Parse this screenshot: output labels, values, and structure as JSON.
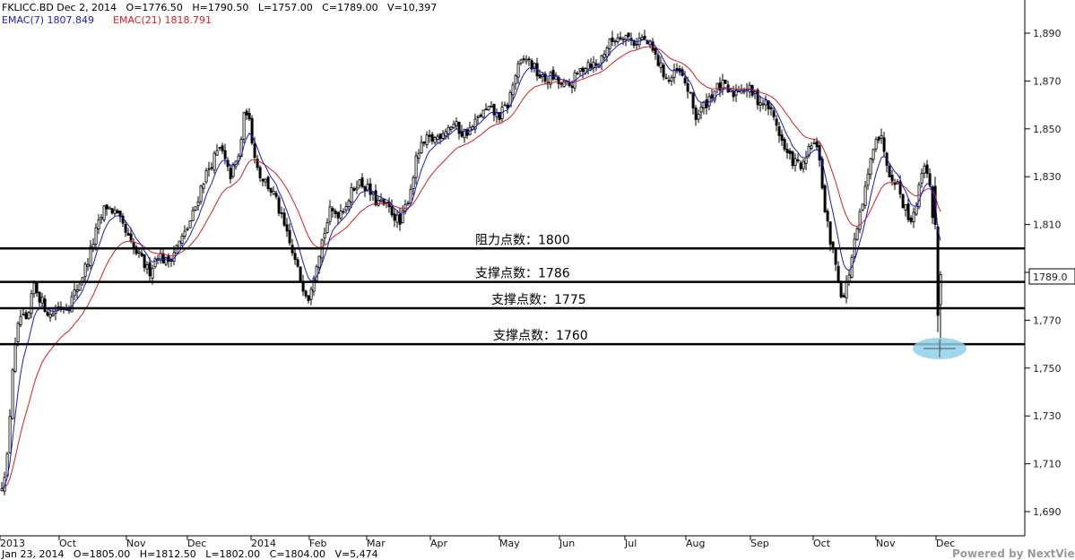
{
  "header": {
    "line1": "FKLICC.BD Dec 2, 2014   O=1776.50   H=1790.50   L=1757.00   C=1789.00   V=10,397",
    "ema7": "EMAC(7) 1807.849",
    "ema21": "EMAC(21) 1818.791"
  },
  "footer": {
    "info": "Jan 23, 2014   O=1805.00   H=1812.50   L=1802.00   C=1804.00   V=5,474",
    "credit": "Powered by NextView"
  },
  "price_badge": "1789.0",
  "colors": {
    "ema7": "#1a1acc",
    "ema21": "#d42020",
    "candle": "#000000",
    "marker": "#8fd0e6",
    "grid": "#000000"
  },
  "chart_data": {
    "type": "candlestick",
    "yticks": [
      1690,
      1710,
      1730,
      1750,
      1770,
      1790,
      1810,
      1830,
      1850,
      1870,
      1890
    ],
    "ytick_labels": [
      "1,690",
      "1,710",
      "1,730",
      "1,750",
      "1,770",
      "1,790",
      "1,810",
      "1,830",
      "1,850",
      "1,870",
      "1,890"
    ],
    "xtick_labels": [
      "2013",
      "Oct",
      "Nov",
      "Dec",
      "2014",
      "Feb",
      "Mar",
      "Apr",
      "May",
      "Jun",
      "Jul",
      "Aug",
      "Sep",
      "Oct",
      "Nov",
      "Dec"
    ],
    "close_path": [
      [
        0,
        1698
      ],
      [
        8,
        1712
      ],
      [
        14,
        1750
      ],
      [
        22,
        1772
      ],
      [
        30,
        1768
      ],
      [
        38,
        1785
      ],
      [
        46,
        1778
      ],
      [
        56,
        1772
      ],
      [
        66,
        1776
      ],
      [
        76,
        1776
      ],
      [
        88,
        1785
      ],
      [
        98,
        1795
      ],
      [
        108,
        1808
      ],
      [
        118,
        1818
      ],
      [
        128,
        1815
      ],
      [
        138,
        1808
      ],
      [
        148,
        1800
      ],
      [
        158,
        1795
      ],
      [
        166,
        1790
      ],
      [
        176,
        1798
      ],
      [
        186,
        1794
      ],
      [
        196,
        1800
      ],
      [
        206,
        1806
      ],
      [
        216,
        1815
      ],
      [
        226,
        1828
      ],
      [
        236,
        1836
      ],
      [
        246,
        1842
      ],
      [
        256,
        1830
      ],
      [
        266,
        1838
      ],
      [
        274,
        1860
      ],
      [
        280,
        1848
      ],
      [
        288,
        1832
      ],
      [
        296,
        1828
      ],
      [
        306,
        1822
      ],
      [
        316,
        1810
      ],
      [
        326,
        1798
      ],
      [
        336,
        1786
      ],
      [
        344,
        1780
      ],
      [
        350,
        1790
      ],
      [
        358,
        1802
      ],
      [
        368,
        1815
      ],
      [
        378,
        1815
      ],
      [
        388,
        1820
      ],
      [
        398,
        1828
      ],
      [
        408,
        1826
      ],
      [
        418,
        1820
      ],
      [
        428,
        1818
      ],
      [
        438,
        1815
      ],
      [
        446,
        1810
      ],
      [
        456,
        1822
      ],
      [
        466,
        1840
      ],
      [
        476,
        1845
      ],
      [
        486,
        1846
      ],
      [
        496,
        1850
      ],
      [
        506,
        1852
      ],
      [
        516,
        1848
      ],
      [
        526,
        1850
      ],
      [
        536,
        1856
      ],
      [
        546,
        1858
      ],
      [
        556,
        1855
      ],
      [
        566,
        1860
      ],
      [
        576,
        1874
      ],
      [
        586,
        1880
      ],
      [
        596,
        1875
      ],
      [
        606,
        1870
      ],
      [
        616,
        1872
      ],
      [
        626,
        1868
      ],
      [
        636,
        1868
      ],
      [
        646,
        1874
      ],
      [
        656,
        1878
      ],
      [
        666,
        1876
      ],
      [
        676,
        1884
      ],
      [
        686,
        1888
      ],
      [
        696,
        1890
      ],
      [
        706,
        1886
      ],
      [
        716,
        1888
      ],
      [
        726,
        1884
      ],
      [
        736,
        1876
      ],
      [
        746,
        1870
      ],
      [
        756,
        1874
      ],
      [
        766,
        1868
      ],
      [
        776,
        1855
      ],
      [
        786,
        1860
      ],
      [
        796,
        1866
      ],
      [
        806,
        1868
      ],
      [
        816,
        1864
      ],
      [
        826,
        1868
      ],
      [
        836,
        1866
      ],
      [
        846,
        1862
      ],
      [
        856,
        1860
      ],
      [
        866,
        1852
      ],
      [
        876,
        1840
      ],
      [
        886,
        1836
      ],
      [
        896,
        1834
      ],
      [
        906,
        1845
      ],
      [
        914,
        1838
      ],
      [
        920,
        1815
      ],
      [
        928,
        1800
      ],
      [
        934,
        1790
      ],
      [
        940,
        1778
      ],
      [
        946,
        1788
      ],
      [
        952,
        1800
      ],
      [
        960,
        1815
      ],
      [
        968,
        1830
      ],
      [
        976,
        1848
      ],
      [
        984,
        1845
      ],
      [
        992,
        1832
      ],
      [
        1000,
        1828
      ],
      [
        1008,
        1818
      ],
      [
        1016,
        1812
      ],
      [
        1024,
        1822
      ],
      [
        1030,
        1838
      ],
      [
        1036,
        1828
      ],
      [
        1042,
        1808
      ],
      [
        1046,
        1790
      ],
      [
        1049,
        1789
      ]
    ],
    "levels": [
      {
        "label": "阻力点数：1800",
        "value": 1800,
        "type": "resistance"
      },
      {
        "label": "支撑点数：1786",
        "value": 1786,
        "type": "support"
      },
      {
        "label": "支撑点数：1775",
        "value": 1775,
        "type": "support"
      },
      {
        "label": "支撑点数：1760",
        "value": 1760,
        "type": "support"
      }
    ],
    "last_candle": {
      "date": "Dec 2, 2014",
      "open": 1776.5,
      "high": 1790.5,
      "low": 1757.0,
      "close": 1789.0,
      "volume": 10397
    },
    "series": [
      {
        "name": "EMAC(7)",
        "last": 1807.849
      },
      {
        "name": "EMAC(21)",
        "last": 1818.791
      }
    ]
  }
}
